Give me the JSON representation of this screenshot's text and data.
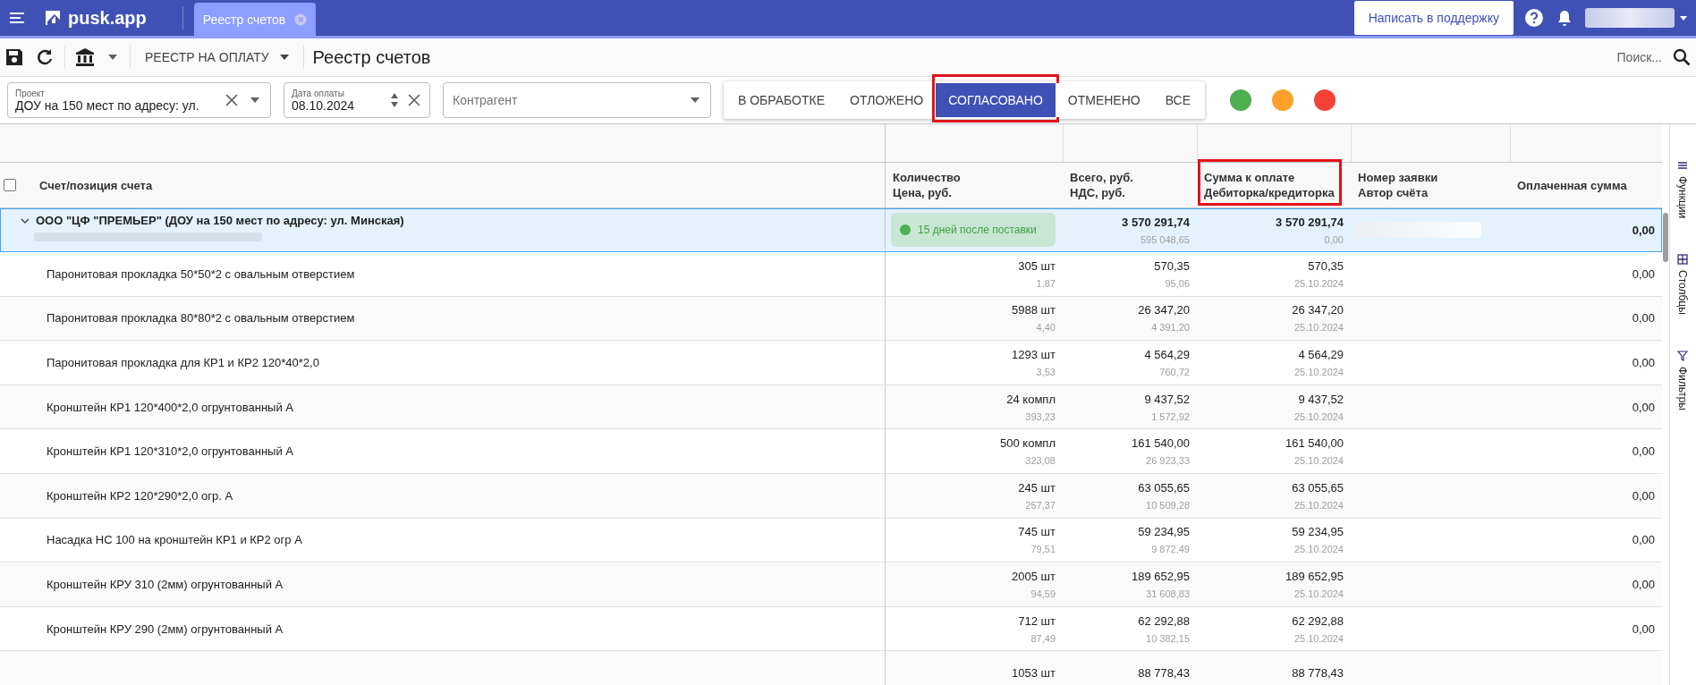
{
  "app_bar": {
    "logo": "pusk.app",
    "tabs": [
      {
        "label": "Реестр счетов",
        "selected": true
      }
    ],
    "support_button": "Написать в поддержку"
  },
  "toolbar": {
    "registry_dropdown": "РЕЕСТР НА ОПЛАТУ",
    "title": "Реестр счетов",
    "search": {
      "placeholder": "Поиск..."
    }
  },
  "filters": {
    "project": {
      "label": "Проект",
      "value": "ДОУ на 150 мест по адресу: ул."
    },
    "payment_date": {
      "label": "Дата оплаты",
      "value": "08.10.2024"
    },
    "counterparty": {
      "placeholder": "Контрагент"
    },
    "status_tabs": [
      {
        "label": "В ОБРАБОТКЕ",
        "selected": false,
        "highlighted": false
      },
      {
        "label": "ОТЛОЖЕНО",
        "selected": false,
        "highlighted": false
      },
      {
        "label": "СОГЛАСОВАНО",
        "selected": true,
        "highlighted": true
      },
      {
        "label": "ОТМЕНЕНО",
        "selected": false,
        "highlighted": false
      },
      {
        "label": "ВСЕ",
        "selected": false,
        "highlighted": false
      }
    ],
    "color_filters": [
      {
        "color": "#4caf50"
      },
      {
        "color": "#ffa02a"
      },
      {
        "color": "#f44336"
      }
    ]
  },
  "table": {
    "select_all": {
      "checked": false
    },
    "columns": [
      {
        "lines": [
          "Счет/позиция счета"
        ],
        "highlighted": false
      },
      {
        "lines": [
          "Количество",
          "Цена, руб."
        ],
        "highlighted": false
      },
      {
        "lines": [
          "Всего, руб.",
          "НДС, руб."
        ],
        "highlighted": false
      },
      {
        "lines": [
          "Сумма к оплате",
          "Дебиторка/кредиторка"
        ],
        "highlighted": true
      },
      {
        "lines": [
          "Номер заявки",
          "Автор счёта"
        ],
        "highlighted": false
      },
      {
        "lines": [
          "Оплаченная сумма"
        ],
        "highlighted": false
      }
    ],
    "group": {
      "name": "ООО \"ЦФ \"ПРЕМЬЕР\" (ДОУ на 150 мест по адресу: ул. Минская)",
      "expanded": true,
      "terms": {
        "label": "15 дней после поставки",
        "color": "#4caf50"
      },
      "total": "3 570 291,74",
      "vat": "595 048,65",
      "to_pay": "3 570 291,74",
      "debt": "0,00",
      "paid": "0,00"
    },
    "rows": [
      {
        "name": "Паронитовая прокладка 50*50*2 с овальным отверстием",
        "qty": "305 шт",
        "price": "1,87",
        "total": "570,35",
        "vat": "95,06",
        "to_pay": "570,35",
        "date": "25.10.2024",
        "paid": "0,00"
      },
      {
        "name": "Паронитовая прокладка 80*80*2 с овальным отверстием",
        "qty": "5988 шт",
        "price": "4,40",
        "total": "26 347,20",
        "vat": "4 391,20",
        "to_pay": "26 347,20",
        "date": "25.10.2024",
        "paid": "0,00"
      },
      {
        "name": "Паронитовая прокладка для КР1 и КР2 120*40*2,0",
        "qty": "1293 шт",
        "price": "3,53",
        "total": "4 564,29",
        "vat": "760,72",
        "to_pay": "4 564,29",
        "date": "25.10.2024",
        "paid": "0,00"
      },
      {
        "name": "Кронштейн КР1 120*400*2,0 огрунтованный А",
        "qty": "24 компл",
        "price": "393,23",
        "total": "9 437,52",
        "vat": "1 572,92",
        "to_pay": "9 437,52",
        "date": "25.10.2024",
        "paid": "0,00"
      },
      {
        "name": "Кронштейн КР1 120*310*2,0 огрунтованный А",
        "qty": "500 компл",
        "price": "323,08",
        "total": "161 540,00",
        "vat": "26 923,33",
        "to_pay": "161 540,00",
        "date": "25.10.2024",
        "paid": "0,00"
      },
      {
        "name": "Кронштейн КР2 120*290*2,0 огр. А",
        "qty": "245 шт",
        "price": "257,37",
        "total": "63 055,65",
        "vat": "10 509,28",
        "to_pay": "63 055,65",
        "date": "25.10.2024",
        "paid": "0,00"
      },
      {
        "name": "Насадка НС 100 на кронштейн КР1 и КР2 огр А",
        "qty": "745 шт",
        "price": "79,51",
        "total": "59 234,95",
        "vat": "9 872,49",
        "to_pay": "59 234,95",
        "date": "25.10.2024",
        "paid": "0,00"
      },
      {
        "name": "Кронштейн КРУ 310 (2мм) огрунтованный А",
        "qty": "2005 шт",
        "price": "94,59",
        "total": "189 652,95",
        "vat": "31 608,83",
        "to_pay": "189 652,95",
        "date": "25.10.2024",
        "paid": "0,00"
      },
      {
        "name": "Кронштейн КРУ 290 (2мм) огрунтованный А",
        "qty": "712 шт",
        "price": "87,49",
        "total": "62 292,88",
        "vat": "10 382,15",
        "to_pay": "62 292,88",
        "date": "25.10.2024",
        "paid": "0,00"
      },
      {
        "qty": "1053 шт",
        "total": "88 778,43",
        "to_pay": "88 778,43"
      }
    ]
  },
  "side_panel": [
    {
      "label": "Функции",
      "kind": "functions"
    },
    {
      "label": "Столбцы",
      "kind": "columns"
    },
    {
      "label": "Фильтры",
      "kind": "filters"
    }
  ]
}
